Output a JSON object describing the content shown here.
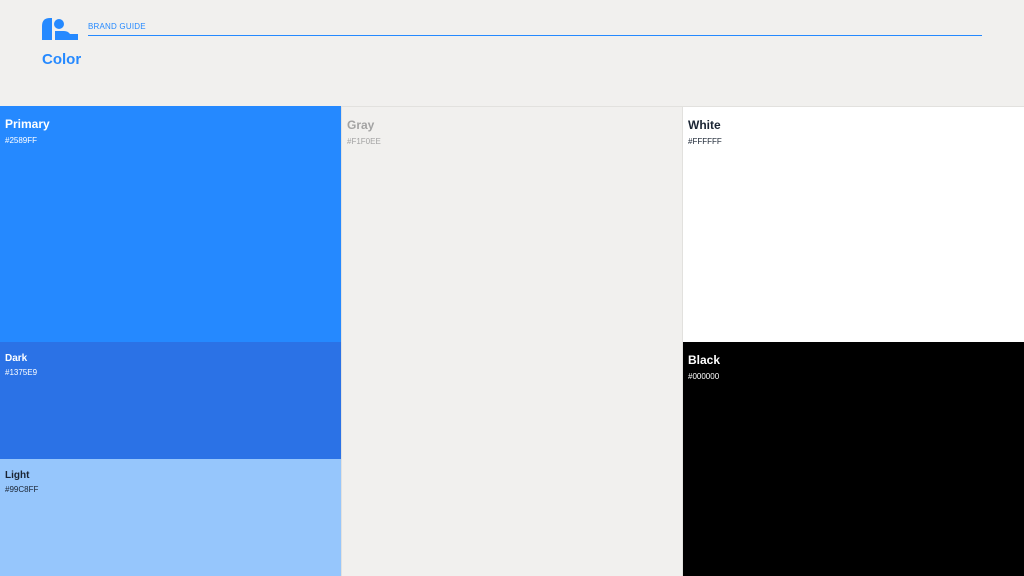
{
  "header": {
    "brand_label": "BRAND GUIDE",
    "title": "Color",
    "logo_icon": "brand-logo-icon"
  },
  "swatches": {
    "primary": {
      "name": "Primary",
      "hex": "#2589FF",
      "color": "#2589FF"
    },
    "dark": {
      "name": "Dark",
      "hex": "#1375E9",
      "color": "#2B72E6"
    },
    "light": {
      "name": "Light",
      "hex": "#99C8FF",
      "color": "#96C6FC"
    },
    "gray": {
      "name": "Gray",
      "hex": "#F1F0EE",
      "color": "#F1F0EE"
    },
    "white": {
      "name": "White",
      "hex": "#FFFFFF",
      "color": "#FFFFFF"
    },
    "black": {
      "name": "Black",
      "hex": "#000000",
      "color": "#000000"
    }
  }
}
